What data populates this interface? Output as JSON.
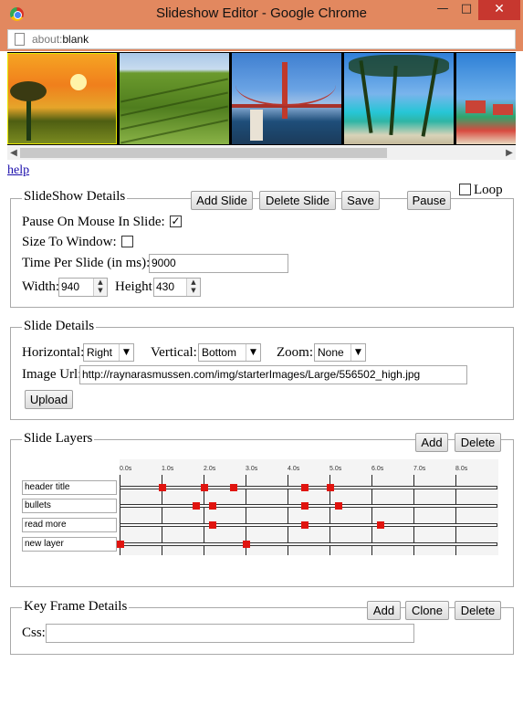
{
  "window": {
    "title": "Slideshow Editor - Google Chrome",
    "minimize": "—",
    "maximize": "□",
    "close": "✕",
    "url_prefix": "about:",
    "url_rest": "blank"
  },
  "thumbnails": [
    "sunset-tree",
    "vineyard",
    "golden-gate-bridge",
    "palm-beach",
    "resort-coast"
  ],
  "help_label": "help",
  "slideshow_details": {
    "legend": "SlideShow Details",
    "add_slide": "Add Slide",
    "delete_slide": "Delete Slide",
    "save": "Save",
    "pause": "Pause",
    "loop_label": "Loop",
    "pause_on_mouse_label": "Pause On Mouse In Slide:",
    "pause_on_mouse_checked": true,
    "size_to_window_label": "Size To Window:",
    "size_to_window_checked": false,
    "time_per_slide_label": "Time Per Slide (in ms):",
    "time_per_slide_value": "9000",
    "width_label": "Width:",
    "width_value": "940",
    "height_label": "Height:",
    "height_value": "430"
  },
  "slide_details": {
    "legend": "Slide Details",
    "horizontal_label": "Horizontal:",
    "horizontal_value": "Right",
    "vertical_label": "Vertical:",
    "vertical_value": "Bottom",
    "zoom_label": "Zoom:",
    "zoom_value": "None",
    "image_url_label": "Image Url:",
    "image_url_value": "http://raynarasmussen.com/img/starterImages/Large/556502_high.jpg",
    "upload": "Upload"
  },
  "slide_layers": {
    "legend": "Slide Layers",
    "add": "Add",
    "delete": "Delete",
    "time_ticks": [
      "0.0s",
      "1.0s",
      "2.0s",
      "3.0s",
      "4.0s",
      "5.0s",
      "6.0s",
      "7.0s",
      "8.0s"
    ],
    "layers": [
      {
        "name": "header title",
        "keyframes_s": [
          1.0,
          2.0,
          2.7,
          4.4,
          5.0
        ]
      },
      {
        "name": "bullets",
        "keyframes_s": [
          1.8,
          2.2,
          4.4,
          5.2
        ]
      },
      {
        "name": "read more",
        "keyframes_s": [
          2.2,
          4.4,
          6.2
        ]
      },
      {
        "name": "new layer",
        "keyframes_s": [
          0.0,
          3.0
        ]
      }
    ]
  },
  "key_frame_details": {
    "legend": "Key Frame Details",
    "add": "Add",
    "clone": "Clone",
    "delete": "Delete",
    "css_label": "Css:",
    "css_value": ""
  }
}
